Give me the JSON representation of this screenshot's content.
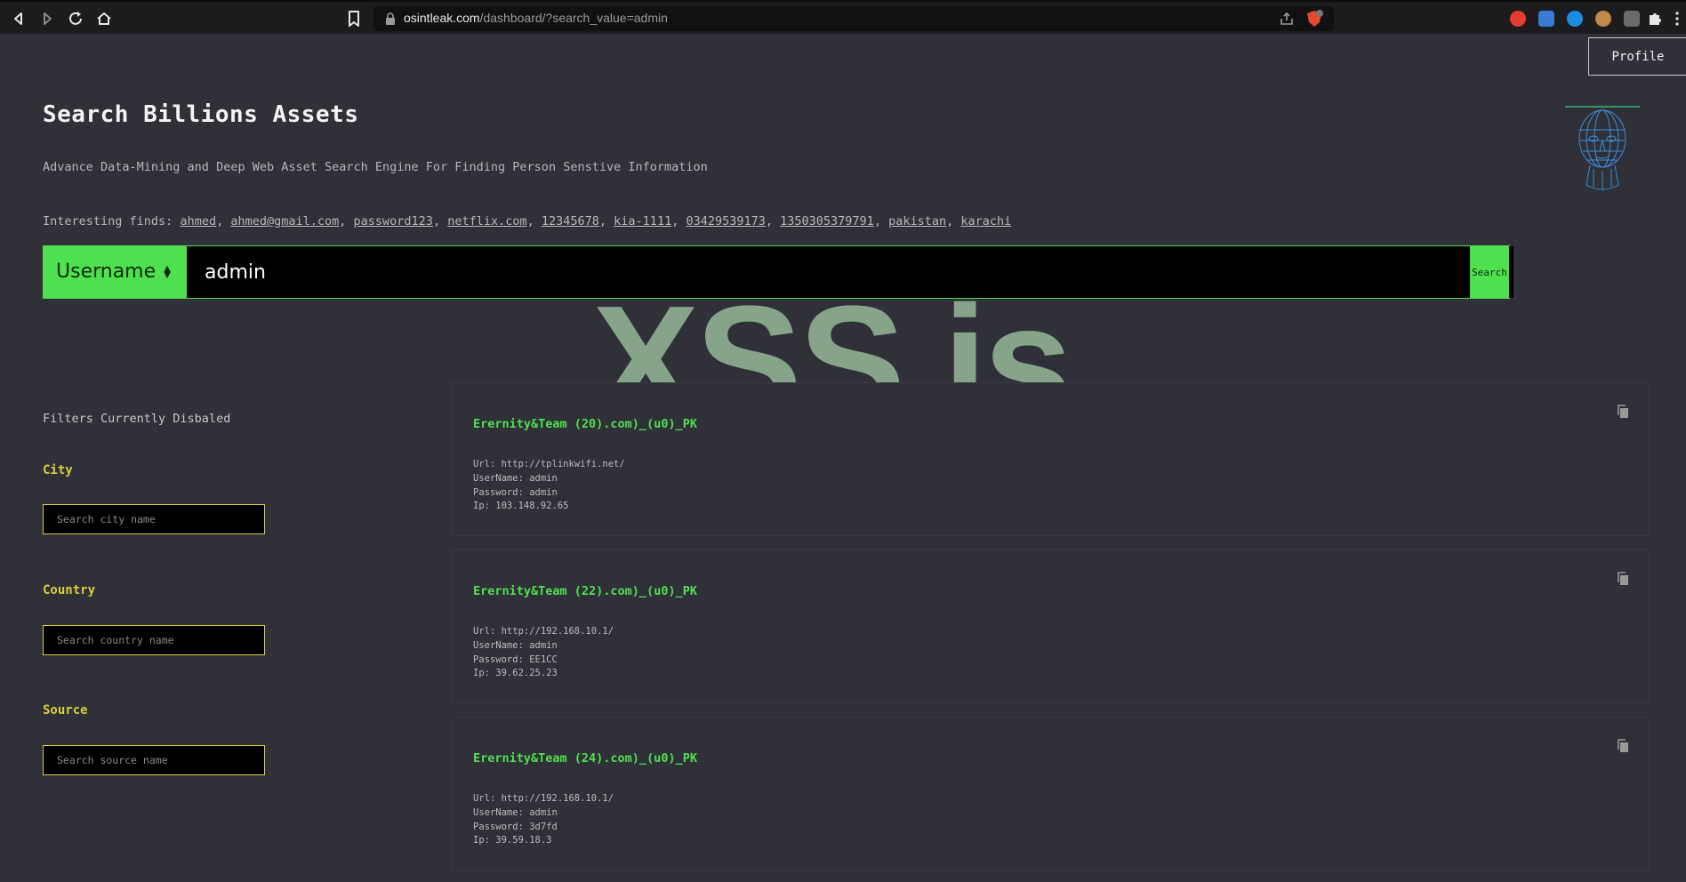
{
  "browser": {
    "url_host": "osintleak.com",
    "url_path": "/dashboard/?search_value=admin",
    "icons": [
      "back-icon",
      "forward-icon",
      "reload-icon",
      "home-icon",
      "bookmark-icon",
      "lock-icon",
      "share-icon",
      "brave-shield-icon"
    ]
  },
  "header": {
    "profile_label": "Profile",
    "title": "Search Billions Assets",
    "subtitle": "Advance Data-Mining and Deep Web Asset Search Engine For Finding Person Senstive Information",
    "finds_label": "Interesting finds: ",
    "finds": [
      "ahmed",
      "ahmed@gmail.com",
      "password123",
      "netflix.com",
      "12345678",
      "kia-1111",
      "03429539173",
      "1350305379791",
      "pakistan",
      "karachi"
    ]
  },
  "search": {
    "type_label": "Username",
    "value": "admin",
    "button_label": "Search"
  },
  "watermark": "XSS.is",
  "filters": {
    "note": "Filters Currently Disbaled",
    "city_label": "City",
    "city_placeholder": "Search city name",
    "country_label": "Country",
    "country_placeholder": "Search country name",
    "source_label": "Source",
    "source_placeholder": "Search source name"
  },
  "results": [
    {
      "title": "Erernity&Team (20).com)_(u0)_PK",
      "url": "Url: http://tplinkwifi.net/",
      "username": "UserName: admin",
      "password": "Password: admin",
      "ip": "Ip: 103.148.92.65"
    },
    {
      "title": "Erernity&Team (22).com)_(u0)_PK",
      "url": "Url: http://192.168.10.1/",
      "username": "UserName: admin",
      "password": "Password: EE1CC",
      "ip": "Ip: 39.62.25.23"
    },
    {
      "title": "Erernity&Team (24).com)_(u0)_PK",
      "url": "Url: http://192.168.10.1/",
      "username": "UserName: admin",
      "password": "Password: 3d7fd",
      "ip": "Ip: 39.59.18.3"
    }
  ],
  "colors": {
    "accent_green": "#4fe04f",
    "filter_yellow": "#d9cf3a",
    "background": "#2f3038",
    "watermark": "#86a48a"
  }
}
